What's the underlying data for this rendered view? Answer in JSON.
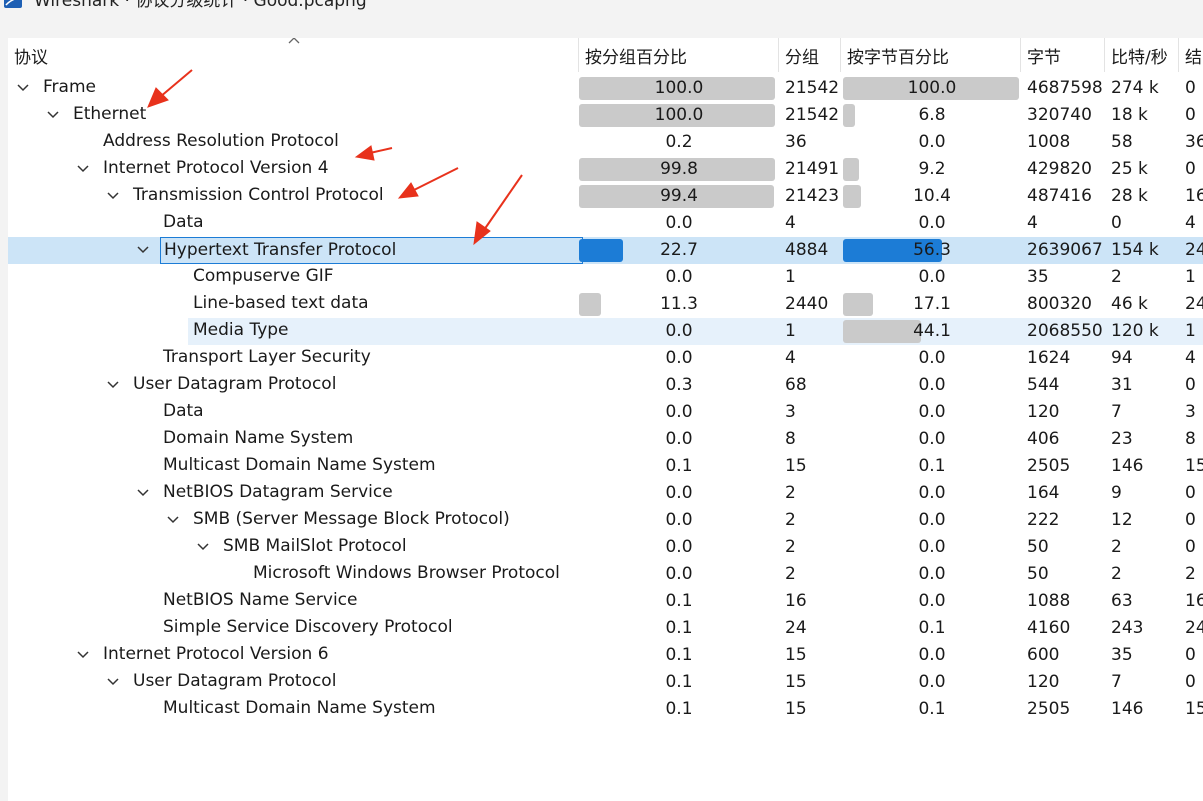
{
  "window": {
    "title": "Wireshark · 协议分级统计 · Good.pcapng"
  },
  "columns": [
    "协议",
    "按分组百分比",
    "分组",
    "按字节百分比",
    "字节",
    "比特/秒",
    "结"
  ],
  "rows": [
    {
      "name": "Frame",
      "pct_packets": "100.0",
      "packets": "21542",
      "pct_bytes": "100.0",
      "bytes": "4687598",
      "bps": "274 k",
      "end": "0"
    },
    {
      "name": "Ethernet",
      "pct_packets": "100.0",
      "packets": "21542",
      "pct_bytes": "6.8",
      "bytes": "320740",
      "bps": "18 k",
      "end": "0"
    },
    {
      "name": "Address Resolution Protocol",
      "pct_packets": "0.2",
      "packets": "36",
      "pct_bytes": "0.0",
      "bytes": "1008",
      "bps": "58",
      "end": "36"
    },
    {
      "name": "Internet Protocol Version 4",
      "pct_packets": "99.8",
      "packets": "21491",
      "pct_bytes": "9.2",
      "bytes": "429820",
      "bps": "25 k",
      "end": "0"
    },
    {
      "name": "Transmission Control Protocol",
      "pct_packets": "99.4",
      "packets": "21423",
      "pct_bytes": "10.4",
      "bytes": "487416",
      "bps": "28 k",
      "end": "16"
    },
    {
      "name": "Data",
      "pct_packets": "0.0",
      "packets": "4",
      "pct_bytes": "0.0",
      "bytes": "4",
      "bps": "0",
      "end": "4"
    },
    {
      "name": "Hypertext Transfer Protocol",
      "pct_packets": "22.7",
      "packets": "4884",
      "pct_bytes": "56.3",
      "bytes": "2639067",
      "bps": "154 k",
      "end": "24"
    },
    {
      "name": "Compuserve GIF",
      "pct_packets": "0.0",
      "packets": "1",
      "pct_bytes": "0.0",
      "bytes": "35",
      "bps": "2",
      "end": "1"
    },
    {
      "name": "Line-based text data",
      "pct_packets": "11.3",
      "packets": "2440",
      "pct_bytes": "17.1",
      "bytes": "800320",
      "bps": "46 k",
      "end": "24"
    },
    {
      "name": "Media Type",
      "pct_packets": "0.0",
      "packets": "1",
      "pct_bytes": "44.1",
      "bytes": "2068550",
      "bps": "120 k",
      "end": "1"
    },
    {
      "name": "Transport Layer Security",
      "pct_packets": "0.0",
      "packets": "4",
      "pct_bytes": "0.0",
      "bytes": "1624",
      "bps": "94",
      "end": "4"
    },
    {
      "name": "User Datagram Protocol",
      "pct_packets": "0.3",
      "packets": "68",
      "pct_bytes": "0.0",
      "bytes": "544",
      "bps": "31",
      "end": "0"
    },
    {
      "name": "Data",
      "pct_packets": "0.0",
      "packets": "3",
      "pct_bytes": "0.0",
      "bytes": "120",
      "bps": "7",
      "end": "3"
    },
    {
      "name": "Domain Name System",
      "pct_packets": "0.0",
      "packets": "8",
      "pct_bytes": "0.0",
      "bytes": "406",
      "bps": "23",
      "end": "8"
    },
    {
      "name": "Multicast Domain Name System",
      "pct_packets": "0.1",
      "packets": "15",
      "pct_bytes": "0.1",
      "bytes": "2505",
      "bps": "146",
      "end": "15"
    },
    {
      "name": "NetBIOS Datagram Service",
      "pct_packets": "0.0",
      "packets": "2",
      "pct_bytes": "0.0",
      "bytes": "164",
      "bps": "9",
      "end": "0"
    },
    {
      "name": "SMB (Server Message Block Protocol)",
      "pct_packets": "0.0",
      "packets": "2",
      "pct_bytes": "0.0",
      "bytes": "222",
      "bps": "12",
      "end": "0"
    },
    {
      "name": "SMB MailSlot Protocol",
      "pct_packets": "0.0",
      "packets": "2",
      "pct_bytes": "0.0",
      "bytes": "50",
      "bps": "2",
      "end": "0"
    },
    {
      "name": "Microsoft Windows Browser Protocol",
      "pct_packets": "0.0",
      "packets": "2",
      "pct_bytes": "0.0",
      "bytes": "50",
      "bps": "2",
      "end": "2"
    },
    {
      "name": "NetBIOS Name Service",
      "pct_packets": "0.1",
      "packets": "16",
      "pct_bytes": "0.0",
      "bytes": "1088",
      "bps": "63",
      "end": "16"
    },
    {
      "name": "Simple Service Discovery Protocol",
      "pct_packets": "0.1",
      "packets": "24",
      "pct_bytes": "0.1",
      "bytes": "4160",
      "bps": "243",
      "end": "24"
    },
    {
      "name": "Internet Protocol Version 6",
      "pct_packets": "0.1",
      "packets": "15",
      "pct_bytes": "0.0",
      "bytes": "600",
      "bps": "35",
      "end": "0"
    },
    {
      "name": "User Datagram Protocol",
      "pct_packets": "0.1",
      "packets": "15",
      "pct_bytes": "0.0",
      "bytes": "120",
      "bps": "7",
      "end": "0"
    },
    {
      "name": "Multicast Domain Name System",
      "pct_packets": "0.1",
      "packets": "15",
      "pct_bytes": "0.1",
      "bytes": "2505",
      "bps": "146",
      "end": "15"
    }
  ],
  "colors": {
    "selection": "#cce4f7",
    "hover": "#e6f1fb",
    "bar_gray": "#cacaca",
    "bar_blue": "#1c7cd6",
    "annotation": "#e8321c"
  }
}
